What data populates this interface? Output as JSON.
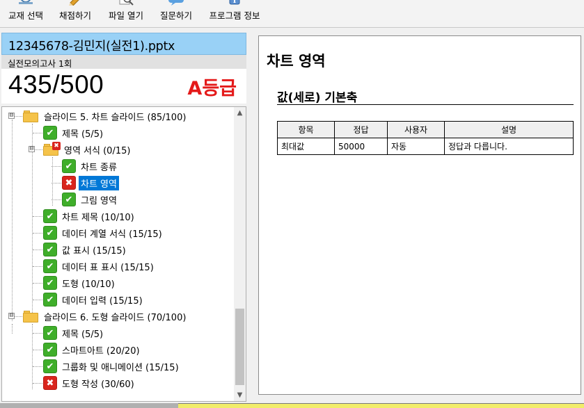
{
  "toolbar": {
    "buttons": [
      {
        "label": "교재 선택"
      },
      {
        "label": "채점하기"
      },
      {
        "label": "파일 열기"
      },
      {
        "label": "질문하기"
      },
      {
        "label": "프로그램 정보"
      }
    ]
  },
  "file": {
    "name": "12345678-김민지(실전1).pptx",
    "exam": "실전모의고사 1회",
    "score": "435/500",
    "grade": "A등급"
  },
  "tree": {
    "items": [
      {
        "label": "슬라이드 5. 차트 슬라이드 (85/100)",
        "icon": "folder-icon"
      },
      {
        "label": "제목 (5/5)",
        "icon": "check-icon"
      },
      {
        "label": "영역 서식 (0/15)",
        "icon": "folder-error-icon"
      },
      {
        "label": "차트 종류",
        "icon": "check-icon"
      },
      {
        "label": "차트 영역",
        "icon": "error-icon"
      },
      {
        "label": "그림 영역",
        "icon": "check-icon"
      },
      {
        "label": "차트 제목 (10/10)",
        "icon": "check-icon"
      },
      {
        "label": "데이터 계열 서식 (15/15)",
        "icon": "check-icon"
      },
      {
        "label": "값 표시 (15/15)",
        "icon": "check-icon"
      },
      {
        "label": "데이터 표 표시 (15/15)",
        "icon": "check-icon"
      },
      {
        "label": "도형 (10/10)",
        "icon": "check-icon"
      },
      {
        "label": "데이터 입력 (15/15)",
        "icon": "check-icon"
      },
      {
        "label": "슬라이드 6. 도형 슬라이드 (70/100)",
        "icon": "folder-icon"
      },
      {
        "label": "제목 (5/5)",
        "icon": "check-icon"
      },
      {
        "label": "스마트아트 (20/20)",
        "icon": "check-icon"
      },
      {
        "label": "그룹화 및 애니메이션 (15/15)",
        "icon": "check-icon"
      },
      {
        "label": "도형 작성 (30/60)",
        "icon": "error-icon"
      }
    ],
    "selected_label": "차트 영역",
    "expanders": [
      "⊟",
      "⊟",
      "⊟"
    ]
  },
  "detail": {
    "title": "차트 영역",
    "subtitle": "값(세로) 기본축",
    "table": {
      "headers": [
        "항목",
        "정답",
        "사용자",
        "설명"
      ],
      "rows": [
        [
          "최대값",
          "50000",
          "자동",
          "정답과 다릅니다."
        ]
      ]
    }
  },
  "icons": {
    "check": "✔",
    "error": "✖",
    "scroll_up": "▲",
    "scroll_down": "▼"
  },
  "colors": {
    "file_bar": "#99d1f6",
    "grade": "#e41a1a",
    "check": "#3fae2a",
    "error": "#d9251d",
    "selection": "#0078d7"
  }
}
